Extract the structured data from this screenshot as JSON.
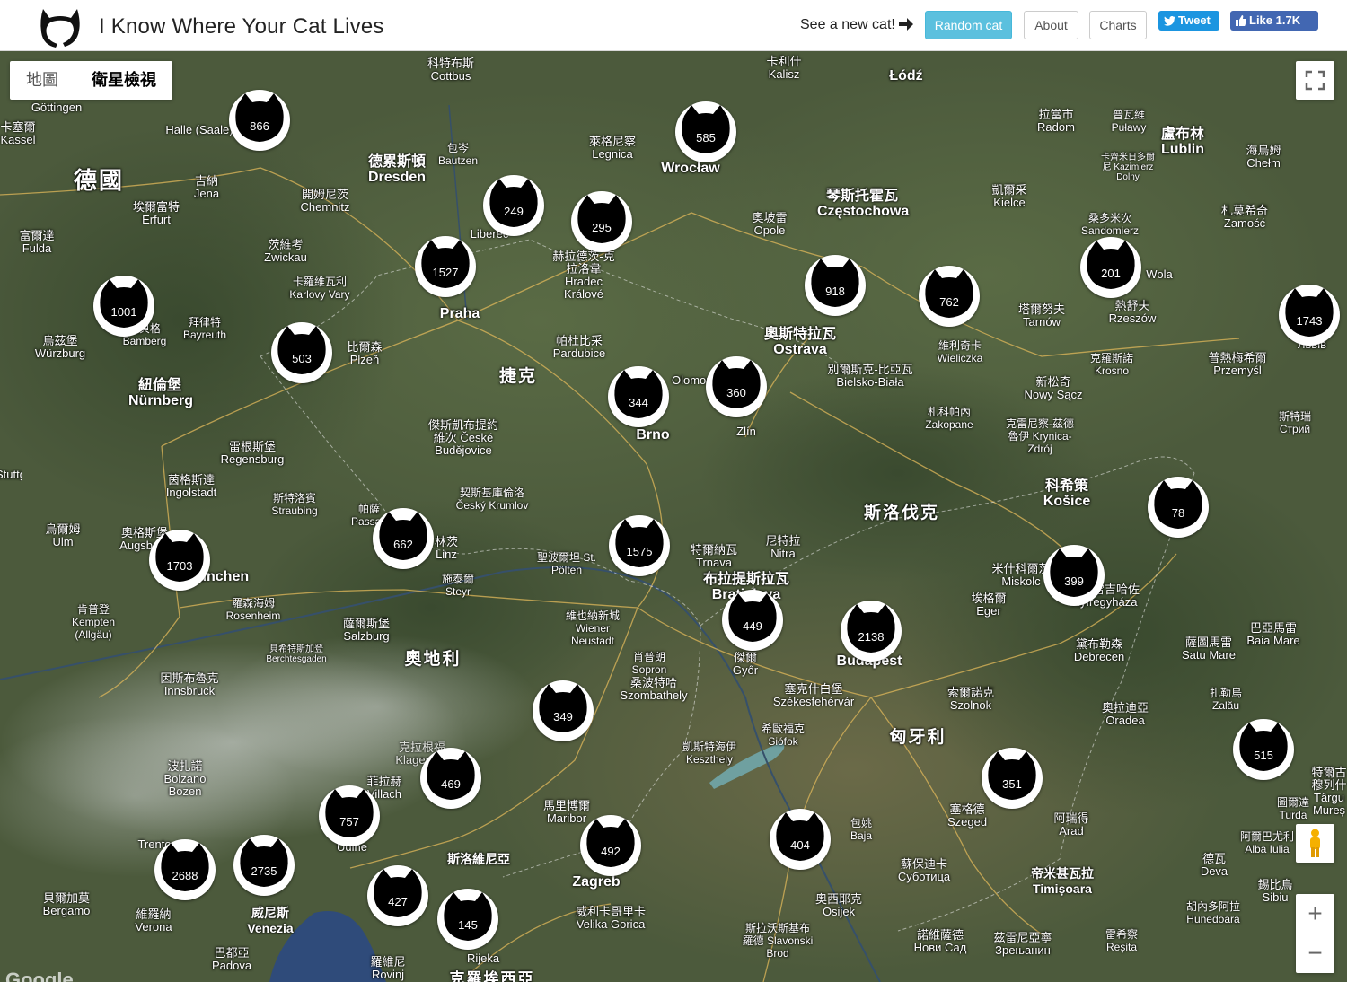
{
  "header": {
    "title": "I Know Where Your Cat Lives",
    "see_new": "See a new cat!",
    "random_label": "Random cat",
    "about_label": "About",
    "charts_label": "Charts",
    "tweet_label": "Tweet",
    "like_label": "Like 1.7K"
  },
  "map_controls": {
    "map_type_map": "地圖",
    "map_type_satellite": "衛星檢視",
    "selected": "satellite",
    "zoom_in": "+",
    "zoom_out": "−",
    "google": "Google"
  },
  "markers": [
    "866",
    "585",
    "249",
    "295",
    "1527",
    "1001",
    "503",
    "918",
    "762",
    "201",
    "1743",
    "344",
    "360",
    "662",
    "1575",
    "1703",
    "78",
    "399",
    "449",
    "2138",
    "349",
    "469",
    "757",
    "492",
    "404",
    "351",
    "515",
    "2688",
    "2735",
    "427",
    "145"
  ],
  "places": [
    "Göttingen",
    "卡塞爾 Kassel",
    "Halle (Saale)",
    "德國",
    "吉納 Jena",
    "埃爾富特 Erfurt",
    "富爾達 Fulda",
    "德累斯頓 Dresden",
    "開姆尼茨 Chemnitz",
    "茨維考 Zwickau",
    "卡羅維瓦利 Karlovy Vary",
    "科特布斯 Cottbus",
    "包岑 Bautzen",
    "萊格尼察 Legnica",
    "Wrocław",
    "Łódź",
    "卡利什 Kalisz",
    "拉當市 Radom",
    "普瓦維 Puławy",
    "盧布林 Lublin",
    "海烏姆 Chełm",
    "卡齊米日多爾尼 Kazimierz Dolny",
    "凱爾采 Kielce",
    "琴斯托霍瓦 Częstochowa",
    "奧坡雷 Opole",
    "桑多米次 Sandomierz",
    "札莫希奇 Zamość",
    "Wola",
    "Praha",
    "Liberec",
    "赫拉德茨-克拉洛韋 Hradec Králové",
    "帕杜比采 Pardubice",
    "捷克",
    "比爾森 Plzeň",
    "班貝格 Bamberg",
    "拜律特 Bayreuth",
    "烏茲堡 Würzburg",
    "紐倫堡 Nürnberg",
    "雷根斯堡 Regensburg",
    "傑斯凱布提約維次 České Budějovice",
    "契斯基庫倫洛 Český Krumlov",
    "奧斯特拉瓦 Ostrava",
    "Olomouc",
    "Zlín",
    "Brno",
    "別爾斯克-比亞瓦 Bielsko-Biała",
    "維利奇卡 Wieliczka",
    "塔爾努夫 Tarnów",
    "熱舒夫 Rzeszów",
    "Львів",
    "普熱梅希爾 Przemyśl",
    "克羅斯諾 Krosno",
    "新松奇 Nowy Sącz",
    "札科帕內 Zakopane",
    "克雷尼察-茲德魯伊 Krynica-Zdrój",
    "斯特瑞 Стрий",
    "斯洛伐克",
    "科希策 Košice",
    "米什科爾茨 Miskolc",
    "埃格爾 Eger",
    "尼赫雷吉哈佐 Nyíregyháza",
    "巴亞馬雷 Baia Mare",
    "薩圖馬雷 Satu Mare",
    "黛布勒森 Debrecen",
    "奧拉迪亞 Oradea",
    "扎勒烏 Zalău",
    "茵格斯達 Ingolstadt",
    "斯特洛賓 Straubing",
    "帕薩 Passau",
    "林茨 Linz",
    "施泰爾 Steyr",
    "聖波爾坦 St. Pölten",
    "特爾納瓦 Trnava",
    "尼特拉 Nitra",
    "布拉提斯拉瓦 Bratislava",
    "維也納新城 Wiener Neustadt",
    "肖普朗 Sopron",
    "桑波特哈 Szombathely",
    "傑爾 Győr",
    "Budapest",
    "塞克什白堡 Székesfehérvár",
    "索爾諾克 Szolnok",
    "匈牙利",
    "希歐福克 Siófok",
    "凱斯特海伊 Keszthely",
    "烏爾姆 Ulm",
    "奧格斯堡 Augsburg",
    "München",
    "羅森海姆 Rosenheim",
    "肯普登 Kempten (Allgäu)",
    "薩爾斯堡 Salzburg",
    "貝希特斯加登 Berchtesgaden",
    "奧地利",
    "因斯布魯克 Innsbruck",
    "波扎諾 Bolzano Bozen",
    "菲拉赫 Villach",
    "克拉根福 Klagenfurt",
    "馬里博爾 Maribor",
    "斯洛維尼亞",
    "Zagreb",
    "威利卡哥里卡 Velika Gorica",
    "包姚 Baja",
    "塞格德 Szeged",
    "蘇保迪卡 Суботица",
    "阿瑞得 Arad",
    "帝米甚瓦拉 Timișoara",
    "諾維薩德 Нови Сад",
    "茲雷尼亞寧 Зрењанин",
    "奧西耶克 Osijek",
    "斯拉沃斯基布羅德 Slavonski Brod",
    "雷希察 Reșita",
    "德瓦 Deva",
    "胡內多阿拉 Hunedoara",
    "阿爾巴尤利 Alba Iulia",
    "圖爾達 Turda",
    "特爾古穆列什 Târgu Mureș",
    "錫比烏 Sibiu",
    "Trento",
    "貝爾加莫 Bergamo",
    "維羅納 Verona",
    "威尼斯 Venezia",
    "巴都亞 Padova",
    "Udine",
    "Rijeka",
    "羅維尼 Rovinj",
    "克羅埃西亞",
    "Stuttgart"
  ]
}
